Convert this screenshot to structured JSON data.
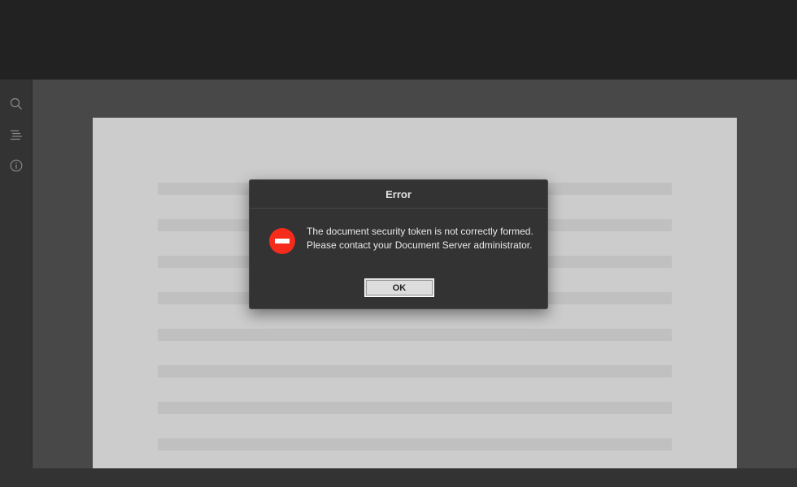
{
  "left_panel": {
    "buttons": [
      {
        "icon": "search-icon"
      },
      {
        "icon": "navigation-icon"
      },
      {
        "icon": "info-icon"
      }
    ]
  },
  "dialog": {
    "title": "Error",
    "icon": "error-stop-icon",
    "message_line1": "The document security token is not correctly formed.",
    "message_line2": "Please contact your Document Server administrator.",
    "ok_label": "OK"
  },
  "colors": {
    "topbar": "#222222",
    "canvas": "#484848",
    "page": "#cccccc",
    "error_red": "#f52b1b"
  }
}
